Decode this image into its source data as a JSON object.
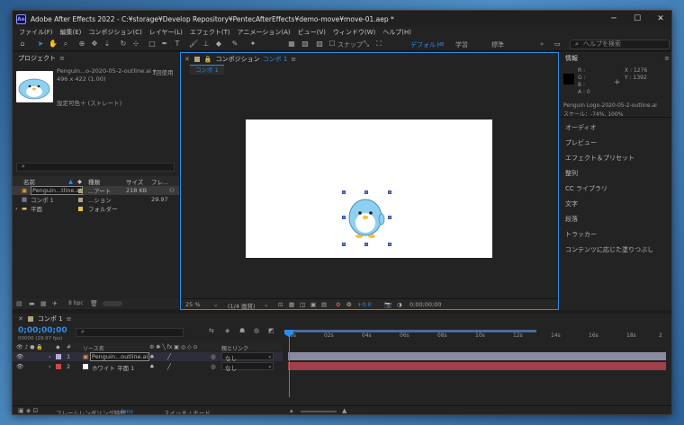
{
  "window": {
    "title": "Adobe After Effects 2022 - C:¥storage¥Develop Repository¥PentecAfterEffects¥demo-move¥move-01.aep *",
    "app_icon": "Ae",
    "controls": [
      "minimize-icon",
      "maximize-icon",
      "close-icon"
    ]
  },
  "menu": [
    "ファイル(F)",
    "編集(E)",
    "コンポジション(C)",
    "レイヤー(L)",
    "エフェクト(T)",
    "アニメーション(A)",
    "ビュー(V)",
    "ウィンドウ(W)",
    "ヘルプ(H)"
  ],
  "toolbar": {
    "snap_label": "スナップ",
    "workspaces": [
      "デフォルト",
      "学習",
      "標準"
    ],
    "help_placeholder": "ヘルプを検索"
  },
  "project": {
    "title": "プロジェクト",
    "item_name": "Penguin...o-2020-05-2-outline.ai ▾",
    "usage": "1回使用",
    "dimensions": "496 x 422 (1.00)",
    "color": "設定可色＋ (ストレート)",
    "columns": [
      "名前",
      "種類",
      "サイズ",
      "フレ..."
    ],
    "rows": [
      {
        "name": "Penguin...tline.ai",
        "type": "...アート",
        "size": "218 KB",
        "frame": "",
        "color": "#b5a27e"
      },
      {
        "name": "コンポ 1",
        "type": "...ション",
        "size": "",
        "frame": "29.97",
        "color": "#b5a27e"
      },
      {
        "name": "平面",
        "type": "フォルダー",
        "size": "",
        "frame": "",
        "color": "#e3c64b"
      }
    ],
    "bpc": "8 bpc"
  },
  "composition": {
    "panel_title": "コンポジション",
    "comp_name": "コンポ 1",
    "tab": "コンポ 1",
    "zoom": "25 %",
    "resolution": "(1/4 画質)",
    "exposure": "+0.0",
    "timecode": "0;00;00;00"
  },
  "info": {
    "title": "情報",
    "r": "R :",
    "g": "G :",
    "b": "B :",
    "a": "A : 0",
    "x": "X : 1276",
    "y": "Y : 1392",
    "layer_name": "Penguin Logo-2020-05-2-outline.ai",
    "scale": "スケール：-74%, 100%",
    "panels": [
      "オーディオ",
      "プレビュー",
      "エフェクト＆プリセット",
      "整列",
      "CC ライブラリ",
      "文字",
      "段落",
      "トラッカー",
      "コンテンツに応じた塗りつぶし"
    ]
  },
  "timeline": {
    "comp_tab": "コンポ 1",
    "timecode": "0;00;00;00",
    "fps_label": "00000 (29.97 fps)",
    "source_header": "ソース名",
    "parent_header": "親とリンク",
    "layers": [
      {
        "num": "1",
        "name": "Penguin...outline.ai",
        "parent": "なし",
        "label_color": "#b8a8e0",
        "bar_color": "#8a8aa0"
      },
      {
        "num": "2",
        "name": "ホワイト 平面 1",
        "parent": "なし",
        "label_color": "#c84a4a",
        "bar_color": "#a0404a"
      }
    ],
    "ruler": [
      "0s",
      "02s",
      "04s",
      "06s",
      "08s",
      "10s",
      "12s",
      "14s",
      "16s",
      "18s",
      "2"
    ],
    "render_time_label": "フレームレンダリング時間",
    "render_time_value": "0ms",
    "switch_mode": "スイッチ / モード"
  }
}
